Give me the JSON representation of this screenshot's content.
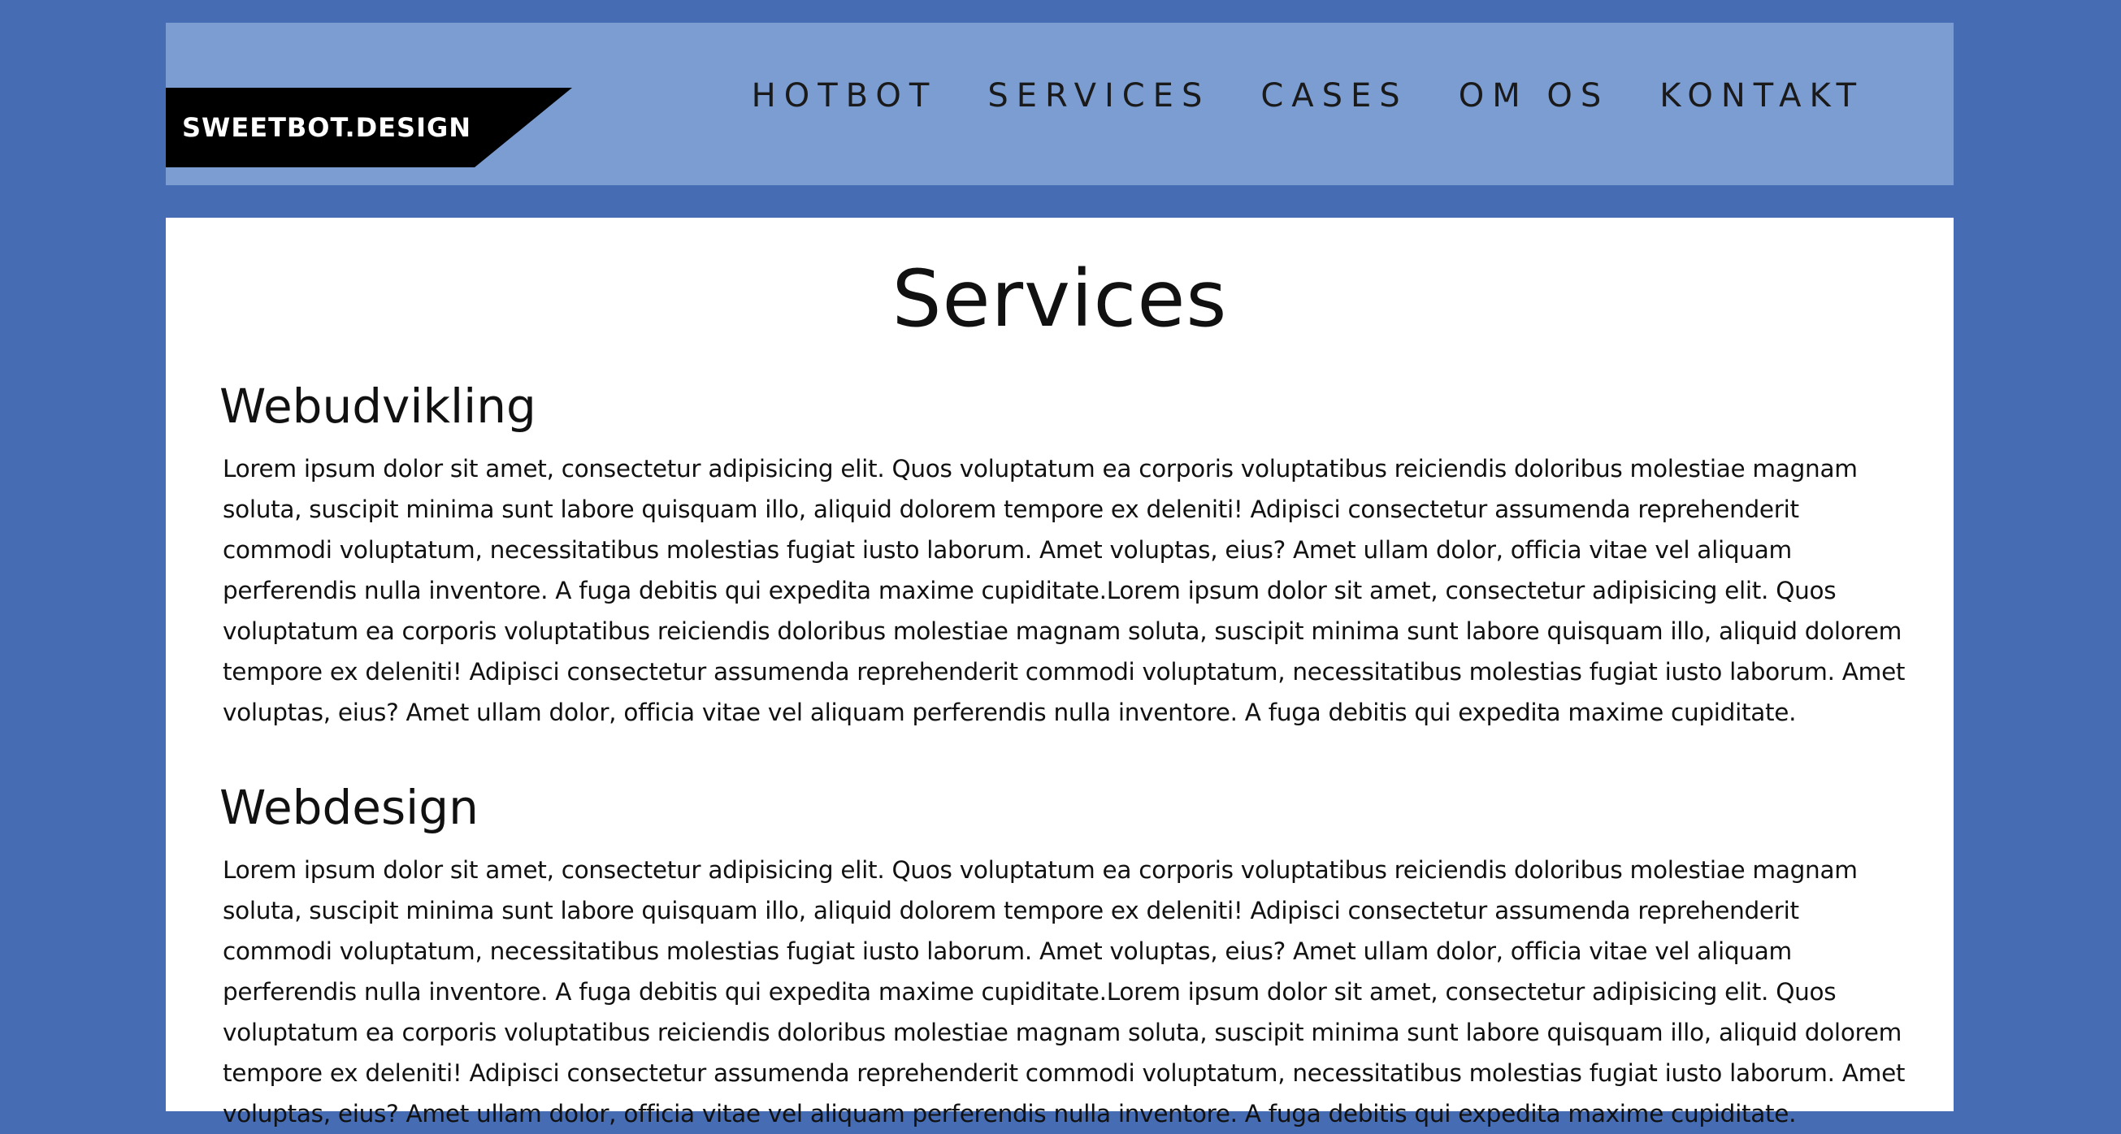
{
  "header": {
    "logo_text": "SWEETBOT.DESIGN",
    "nav": [
      "HOTBOT",
      "SERVICES",
      "CASES",
      "OM OS",
      "KONTAKT"
    ]
  },
  "main": {
    "title": "Services",
    "sections": [
      {
        "heading": "Webudvikling",
        "body": "Lorem ipsum dolor sit amet, consectetur adipisicing elit. Quos voluptatum ea corporis voluptatibus reiciendis doloribus molestiae magnam soluta, suscipit minima sunt labore quisquam illo, aliquid dolorem tempore ex deleniti! Adipisci consectetur assumenda reprehenderit commodi voluptatum, necessitatibus molestias fugiat iusto laborum. Amet voluptas, eius? Amet ullam dolor, officia vitae vel aliquam perferendis nulla inventore. A fuga debitis qui expedita maxime cupiditate.Lorem ipsum dolor sit amet, consectetur adipisicing elit. Quos voluptatum ea corporis voluptatibus reiciendis doloribus molestiae magnam soluta, suscipit minima sunt labore quisquam illo, aliquid dolorem tempore ex deleniti! Adipisci consectetur assumenda reprehenderit commodi voluptatum, necessitatibus molestias fugiat iusto laborum. Amet voluptas, eius? Amet ullam dolor, officia vitae vel aliquam perferendis nulla inventore. A fuga debitis qui expedita maxime cupiditate."
      },
      {
        "heading": "Webdesign",
        "body": "Lorem ipsum dolor sit amet, consectetur adipisicing elit. Quos voluptatum ea corporis voluptatibus reiciendis doloribus molestiae magnam soluta, suscipit minima sunt labore quisquam illo, aliquid dolorem tempore ex deleniti! Adipisci consectetur assumenda reprehenderit commodi voluptatum, necessitatibus molestias fugiat iusto laborum. Amet voluptas, eius? Amet ullam dolor, officia vitae vel aliquam perferendis nulla inventore. A fuga debitis qui expedita maxime cupiditate.Lorem ipsum dolor sit amet, consectetur adipisicing elit. Quos voluptatum ea corporis voluptatibus reiciendis doloribus molestiae magnam soluta, suscipit minima sunt labore quisquam illo, aliquid dolorem tempore ex deleniti! Adipisci consectetur assumenda reprehenderit commodi voluptatum, necessitatibus molestias fugiat iusto laborum. Amet voluptas, eius? Amet ullam dolor, officia vitae vel aliquam perferendis nulla inventore. A fuga debitis qui expedita maxime cupiditate."
      }
    ]
  },
  "colors": {
    "page_background": "#466cb3",
    "header_background": "#7b9dd2",
    "content_background": "#ffffff",
    "logo_background": "#000000"
  }
}
